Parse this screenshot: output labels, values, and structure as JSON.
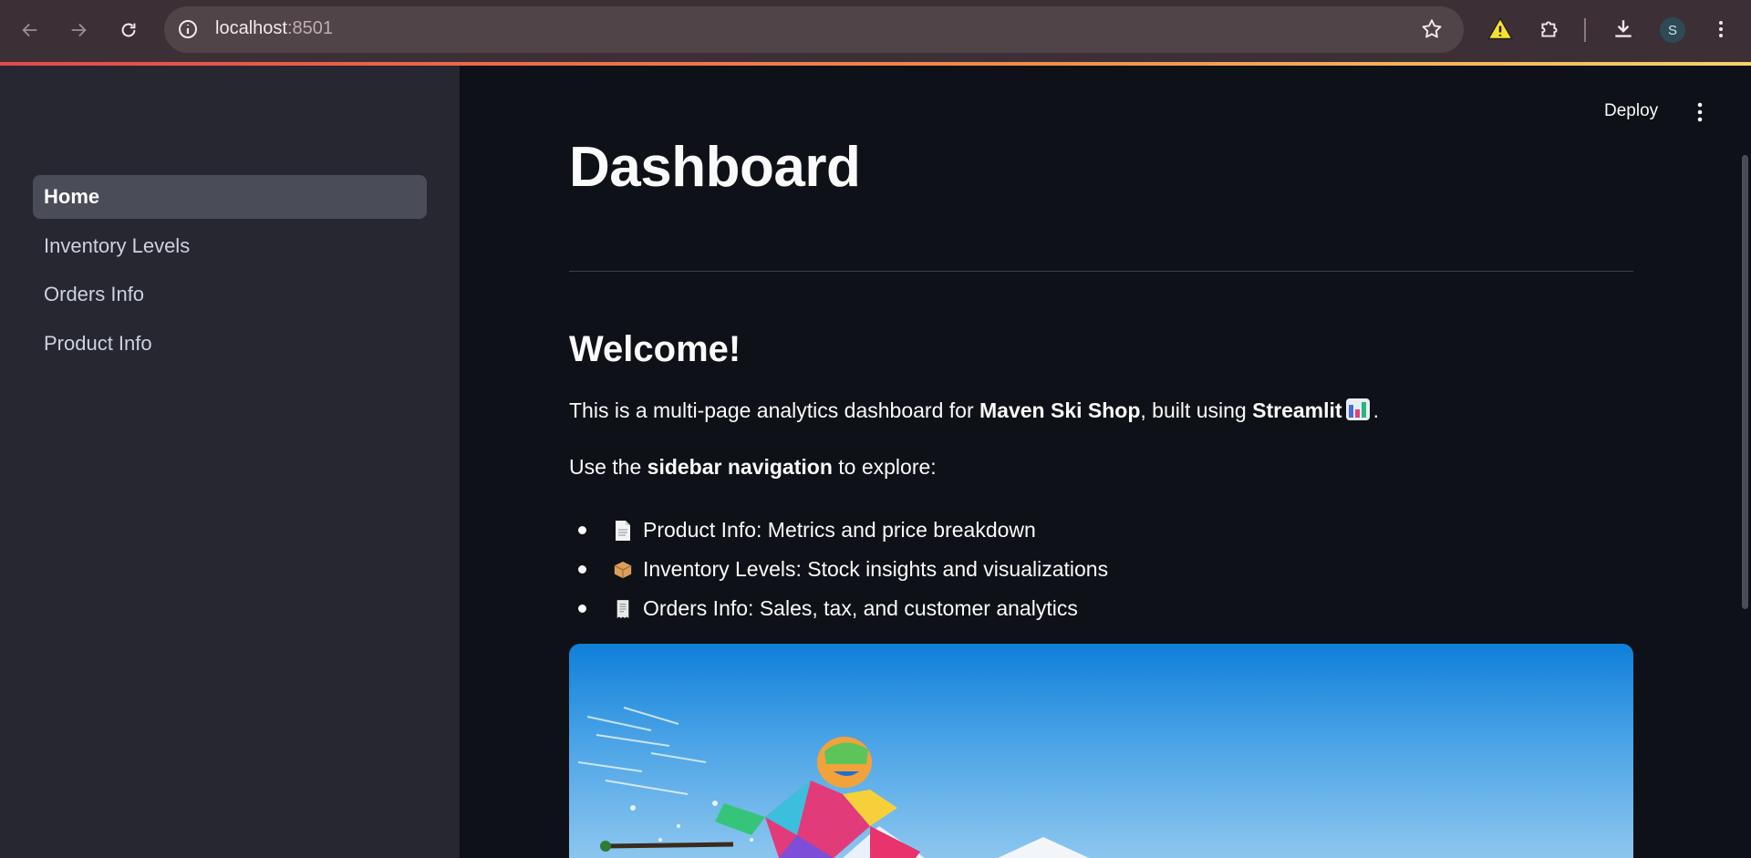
{
  "browser": {
    "url_host": "localhost",
    "url_port": ":8501",
    "profile_initial": "S"
  },
  "sidebar": {
    "items": [
      {
        "label": "Home",
        "active": true
      },
      {
        "label": "Inventory Levels",
        "active": false
      },
      {
        "label": "Orders Info",
        "active": false
      },
      {
        "label": "Product Info",
        "active": false
      }
    ]
  },
  "toolbar": {
    "deploy_label": "Deploy"
  },
  "main": {
    "title": "Dashboard",
    "welcome_heading": "Welcome!",
    "intro": {
      "prefix": "This is a multi-page analytics dashboard for ",
      "shop_name": "Maven Ski Shop",
      "middle": ", built using ",
      "framework": "Streamlit",
      "suffix": "."
    },
    "nav_hint": {
      "prefix": "Use the ",
      "emphasis": "sidebar navigation",
      "suffix": " to explore:"
    },
    "bullets": [
      {
        "icon": "page-icon",
        "text": "Product Info: Metrics and price breakdown"
      },
      {
        "icon": "package-icon",
        "text": "Inventory Levels: Stock insights and visualizations"
      },
      {
        "icon": "receipt-icon",
        "text": "Orders Info: Sales, tax, and customer analytics"
      }
    ]
  },
  "colors": {
    "app_bg": "#0e1117",
    "sidebar_bg": "#262730",
    "active_item_bg": "#4a4c57",
    "text": "#fafafa"
  }
}
